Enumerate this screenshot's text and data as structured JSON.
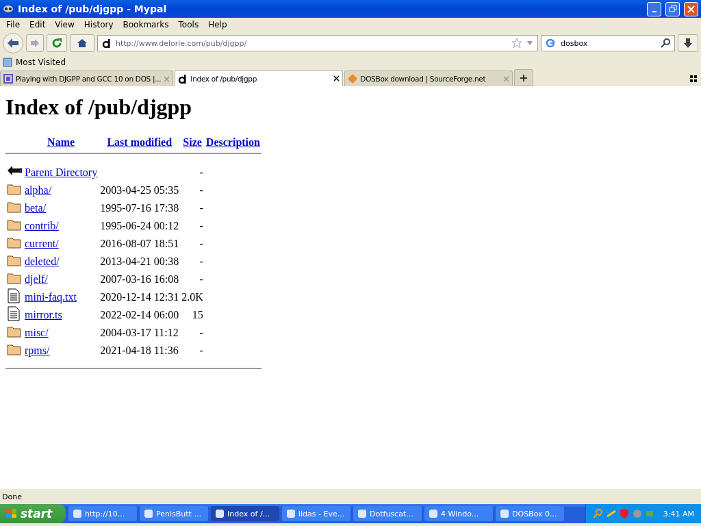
{
  "window": {
    "title": "Index of /pub/djgpp - Mypal"
  },
  "menu": [
    "File",
    "Edit",
    "View",
    "History",
    "Bookmarks",
    "Tools",
    "Help"
  ],
  "toolbar": {
    "url": "http://www.delorie.com/pub/djgpp/",
    "search": {
      "value": "dosbox"
    }
  },
  "bookmarks": [
    "Most Visited"
  ],
  "tabs": [
    {
      "label": "Playing with DJGPP and GCC 10 on DOS |...",
      "selected": false,
      "kind": "square"
    },
    {
      "label": "Index of /pub/djgpp",
      "selected": true,
      "kind": "d"
    },
    {
      "label": "DOSBox download | SourceForge.net",
      "selected": false,
      "kind": "diamond"
    }
  ],
  "page": {
    "heading": "Index of /pub/djgpp",
    "columns": [
      "Name",
      "Last modified",
      "Size",
      "Description"
    ],
    "rows": [
      {
        "kind": "parent",
        "name": "Parent Directory",
        "size": "-"
      },
      {
        "kind": "folder",
        "name": "alpha/",
        "modified": "2003-04-25 05:35",
        "size": "-"
      },
      {
        "kind": "folder",
        "name": "beta/",
        "modified": "1995-07-16 17:38",
        "size": "-"
      },
      {
        "kind": "folder",
        "name": "contrib/",
        "modified": "1995-06-24 00:12",
        "size": "-"
      },
      {
        "kind": "folder",
        "name": "current/",
        "modified": "2016-08-07 18:51",
        "size": "-"
      },
      {
        "kind": "folder",
        "name": "deleted/",
        "modified": "2013-04-21 00:38",
        "size": "-"
      },
      {
        "kind": "folder",
        "name": "djelf/",
        "modified": "2007-03-16 16:08",
        "size": "-"
      },
      {
        "kind": "file",
        "name": "mini-faq.txt",
        "modified": "2020-12-14 12:31",
        "size": "2.0K"
      },
      {
        "kind": "file",
        "name": "mirror.ts",
        "modified": "2022-02-14 06:00",
        "size": "15"
      },
      {
        "kind": "folder",
        "name": "misc/",
        "modified": "2004-03-17 11:12",
        "size": "-"
      },
      {
        "kind": "folder",
        "name": "rpms/",
        "modified": "2021-04-18 11:36",
        "size": "-"
      }
    ]
  },
  "status_bar": "Done",
  "taskbar": {
    "start": "start",
    "items": [
      {
        "label": "http://10...",
        "selected": false
      },
      {
        "label": "PenisButt ...",
        "selected": false
      },
      {
        "label": "Index of /...",
        "selected": true
      },
      {
        "label": "ildas - Eve...",
        "selected": false
      },
      {
        "label": "Dotfuscat...",
        "selected": false
      },
      {
        "label": "4 Windo...",
        "selected": false
      },
      {
        "label": "DOSBox 0...",
        "selected": false
      }
    ],
    "clock": "3:41 AM"
  }
}
